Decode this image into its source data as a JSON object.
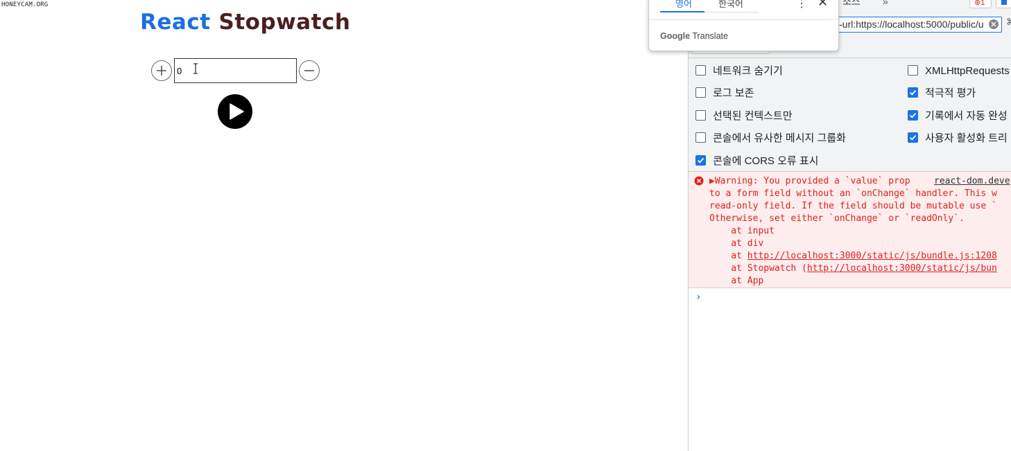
{
  "watermark": "HONEYCAM.ORG",
  "app": {
    "title_part1": "React",
    "title_part2": "Stopwatch",
    "input_value": "0",
    "colors": {
      "title_react": "#1b6fe0",
      "title_stopwatch": "#4a1f1f"
    },
    "icons": {
      "increment": "plus-circle-icon",
      "decrement": "minus-circle-icon",
      "start": "play-icon"
    }
  },
  "translate_popup": {
    "tab_source": "영어",
    "tab_target": "한국어",
    "brand_google": "Google",
    "brand_translate": "Translate"
  },
  "devtools": {
    "tab_sources": "소스",
    "tab_more": "»",
    "error_count": "1",
    "filter_value": "-url:https://localhost:5000/public/u",
    "side_glyph": "⌘",
    "options": [
      {
        "label": "네트워크 숨기기",
        "checked": false
      },
      {
        "label": "로그 보존",
        "checked": false
      },
      {
        "label": "선택된 컨텍스트만",
        "checked": false
      },
      {
        "label": "콘솔에서 유사한 메시지 그룹화",
        "checked": false
      },
      {
        "label": "콘솔에 CORS 오류 표시",
        "checked": true
      },
      {
        "label": "XMLHttpRequests 로",
        "checked": false
      },
      {
        "label": "적극적 평가",
        "checked": true
      },
      {
        "label": "기록에서 자동 완성",
        "checked": true
      },
      {
        "label": "사용자 활성화 트리",
        "checked": true
      }
    ],
    "console": {
      "line1": "▶Warning: You provided a `value` prop",
      "source": "react-dom.deve",
      "line2": "to a form field without an `onChange` handler. This w",
      "line3": "read-only field. If the field should be mutable use `",
      "line4": "Otherwise, set either `onChange` or `readOnly`.",
      "line5": "    at input",
      "line6": "    at div",
      "line7_prefix": "    at ",
      "line7_link": "http://localhost:3000/static/js/bundle.js:1208",
      "line8_prefix": "    at Stopwatch (",
      "line8_link": "http://localhost:3000/static/js/bun",
      "line9": "    at App",
      "prompt": "›"
    },
    "colors": {
      "error_text": "#e02020",
      "error_bg": "#fdeded",
      "accent": "#1a73e8"
    }
  }
}
